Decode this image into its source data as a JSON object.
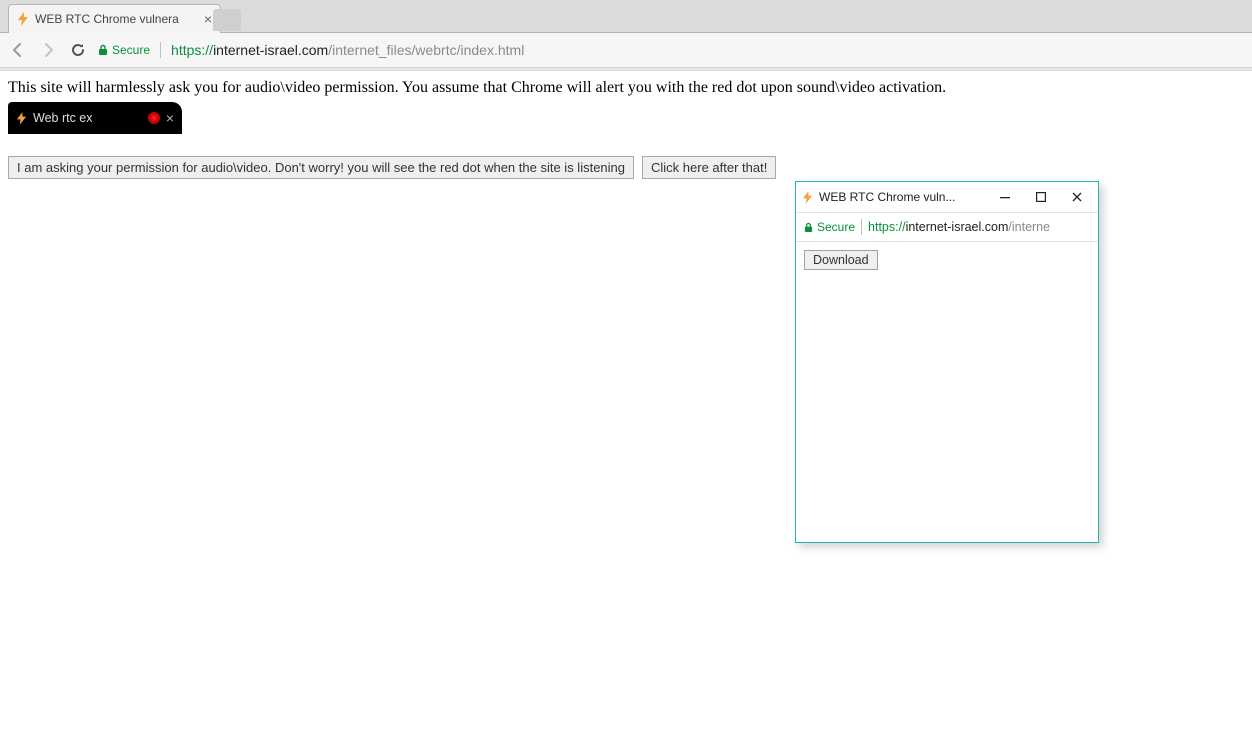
{
  "main_tab": {
    "title": "WEB RTC Chrome vulnera"
  },
  "address": {
    "secure_label": "Secure",
    "scheme": "https://",
    "domain": "internet-israel.com",
    "path": "/internet_files/webrtc/index.html"
  },
  "page": {
    "notice": "This site will harmlessly ask you for audio\\video permission. You assume that Chrome will alert you with the red dot upon sound\\video activation.",
    "fake_tab_title": "Web rtc ex",
    "buttons": {
      "permission": "I am asking your permission for audio\\video. Don't worry! you will see the red dot when the site is listening",
      "after": "Click here after that!"
    }
  },
  "popup": {
    "title": "WEB RTC Chrome vuln...",
    "secure_label": "Secure",
    "url_scheme": "https://",
    "url_domain": "internet-israel.com",
    "url_rest": "/interne",
    "download_label": "Download"
  }
}
